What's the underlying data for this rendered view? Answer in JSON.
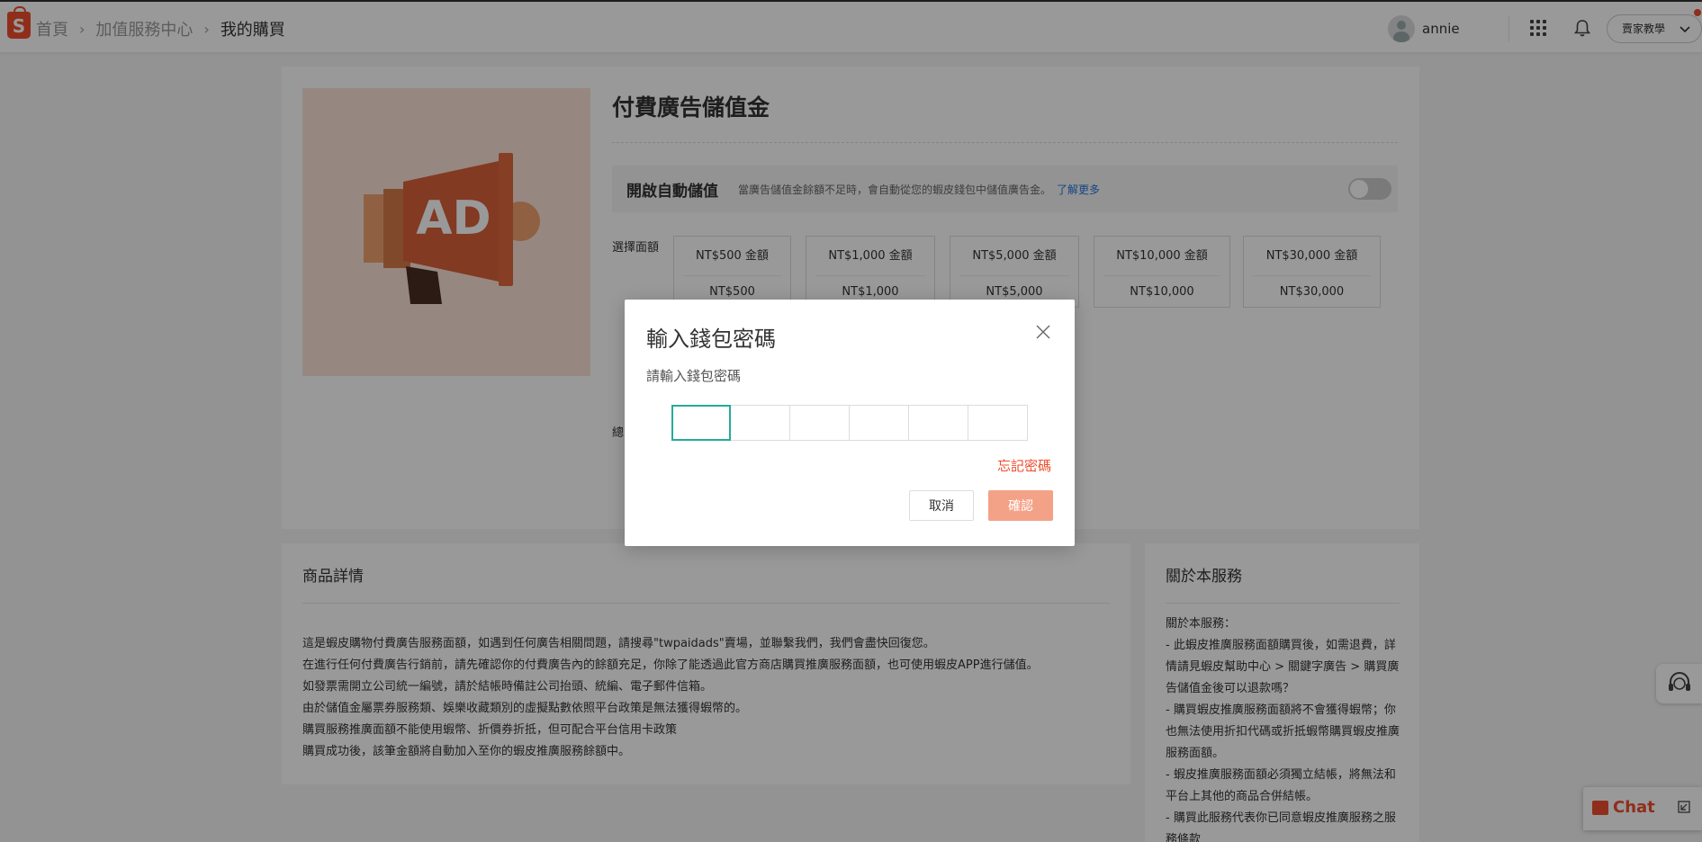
{
  "header": {
    "logo_letter": "S",
    "breadcrumbs": [
      "首頁",
      "加值服務中心",
      "我的購買"
    ],
    "separator": "›",
    "user_name": "annie",
    "help_label": "賣家教學"
  },
  "product": {
    "image_text": "AD",
    "title": "付費廣告儲值金",
    "auto_topup": {
      "title": "開啟自動儲值",
      "description": "當廣告儲值金餘額不足時，會自動從您的蝦皮錢包中儲值廣告金。",
      "learn_more": "了解更多",
      "enabled": false
    },
    "denomination_label": "選擇面額",
    "denominations": [
      {
        "name": "NT$500 金額",
        "price": "NT$500"
      },
      {
        "name": "NT$1,000 金額",
        "price": "NT$1,000"
      },
      {
        "name": "NT$5,000 金額",
        "price": "NT$5,000"
      },
      {
        "name": "NT$10,000 金額",
        "price": "NT$10,000"
      },
      {
        "name": "NT$30,000 金額",
        "price": "NT$30,000"
      }
    ],
    "total_label_fragment": "總"
  },
  "details": {
    "title": "商品詳情",
    "lines": [
      "這是蝦皮購物付費廣告服務面額，如遇到任何廣告相關問題，請搜尋\"twpaidads\"賣場，並聯繫我們，我們會盡快回復您。",
      "在進行任何付費廣告行銷前，請先確認你的付費廣告內的餘額充足，你除了能透過此官方商店購買推廣服務面額，也可使用蝦皮APP進行儲值。",
      "如發票需開立公司統一編號，請於結帳時備註公司抬頭、統編、電子郵件信箱。",
      "由於儲值金屬票券服務類、娛樂收藏類別的虛擬點數依照平台政策是無法獲得蝦幣的。",
      "購買服務推廣面額不能使用蝦幣、折價券折抵，但可配合平台信用卡政策",
      "購買成功後，該筆金額將自動加入至你的蝦皮推廣服務餘額中。"
    ]
  },
  "about": {
    "title": "關於本服務",
    "lines": [
      "關於本服務：",
      "- 此蝦皮推廣服務面額購買後，如需退費，詳情請見蝦皮幫助中心 > 關鍵字廣告 > 購買廣告儲值金後可以退款嗎？",
      "- 購買蝦皮推廣服務面額將不會獲得蝦幣；你也無法使用折扣代碼或折抵蝦幣購買蝦皮推廣服務面額。",
      "- 蝦皮推廣服務面額必須獨立結帳，將無法和平台上其他的商品合併結帳。",
      "- 購買此服務代表你已同意蝦皮推廣服務之服務條款"
    ]
  },
  "chat": {
    "label": "Chat"
  },
  "modal": {
    "title": "輸入錢包密碼",
    "subtitle": "請輸入錢包密碼",
    "pin_length": 6,
    "forgot_label": "忘記密碼",
    "cancel_label": "取消",
    "confirm_label": "確認"
  },
  "colors": {
    "brand": "#ee4d2d",
    "focus": "#26aa99",
    "link": "#2673dd",
    "confirm_disabled": "#f4a287"
  }
}
